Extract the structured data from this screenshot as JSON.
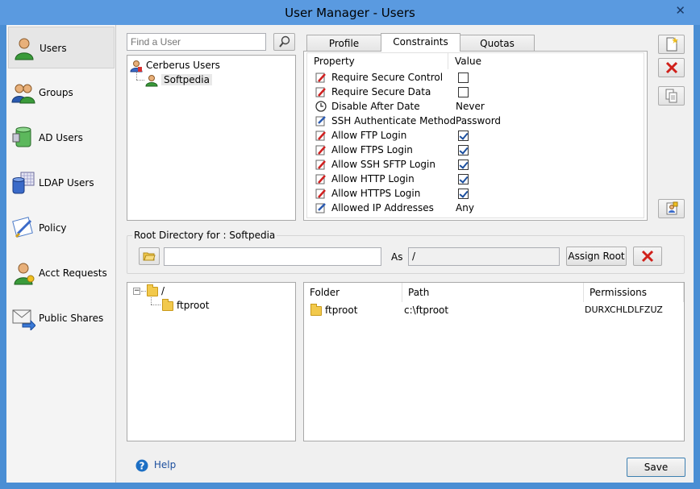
{
  "window": {
    "title": "User Manager - Users",
    "close_glyph": "✕"
  },
  "sidebar": {
    "items": [
      {
        "label": "Users",
        "icon": "user-icon",
        "selected": true
      },
      {
        "label": "Groups",
        "icon": "group-icon"
      },
      {
        "label": "AD Users",
        "icon": "ad-database-icon"
      },
      {
        "label": "LDAP Users",
        "icon": "ldap-database-icon"
      },
      {
        "label": "Policy",
        "icon": "policy-icon"
      },
      {
        "label": "Acct Requests",
        "icon": "account-request-icon"
      },
      {
        "label": "Public Shares",
        "icon": "mail-share-icon"
      }
    ]
  },
  "user_search": {
    "placeholder": "Find a User",
    "value": ""
  },
  "user_tree": {
    "root": "Cerberus Users",
    "child": "Softpedia"
  },
  "tabs": [
    {
      "label": "Profile"
    },
    {
      "label": "Constraints",
      "active": true
    },
    {
      "label": "Quotas"
    }
  ],
  "constraints": {
    "headers": {
      "property": "Property",
      "value": "Value"
    },
    "rows": [
      {
        "property": "Require Secure Control",
        "type": "checkbox",
        "checked": false,
        "icon": "edit-icon"
      },
      {
        "property": "Require Secure Data",
        "type": "checkbox",
        "checked": false,
        "icon": "edit-icon"
      },
      {
        "property": "Disable After Date",
        "type": "text",
        "value": "Never",
        "icon": "clock-icon"
      },
      {
        "property": "SSH Authenticate Method",
        "type": "text",
        "value": "Password",
        "icon": "pencil-note-icon"
      },
      {
        "property": "Allow FTP Login",
        "type": "checkbox",
        "checked": true,
        "icon": "edit-icon"
      },
      {
        "property": "Allow FTPS Login",
        "type": "checkbox",
        "checked": true,
        "icon": "edit-icon"
      },
      {
        "property": "Allow SSH SFTP Login",
        "type": "checkbox",
        "checked": true,
        "icon": "edit-icon"
      },
      {
        "property": "Allow HTTP Login",
        "type": "checkbox",
        "checked": true,
        "icon": "edit-icon"
      },
      {
        "property": "Allow HTTPS Login",
        "type": "checkbox",
        "checked": true,
        "icon": "edit-icon"
      },
      {
        "property": "Allowed IP Addresses",
        "type": "text",
        "value": "Any",
        "icon": "pencil-note-icon"
      }
    ]
  },
  "root_directory": {
    "title": "Root Directory for : Softpedia",
    "path_value": "",
    "as_label": "As",
    "as_value": "/",
    "assign_label": "Assign Root"
  },
  "dir_tree": {
    "root": "/",
    "child": "ftproot"
  },
  "folders_table": {
    "headers": {
      "folder": "Folder",
      "path": "Path",
      "permissions": "Permissions"
    },
    "rows": [
      {
        "folder": "ftproot",
        "path": "c:\\ftproot",
        "permissions": "DURXCHLDLFZUZ"
      }
    ]
  },
  "footer": {
    "help_label": "Help",
    "save_label": "Save"
  },
  "colors": {
    "titlebar": "#5a9ae0",
    "frame": "#4a8ed4",
    "accent_blue": "#1c6fc4",
    "red_x": "#d0201a"
  }
}
